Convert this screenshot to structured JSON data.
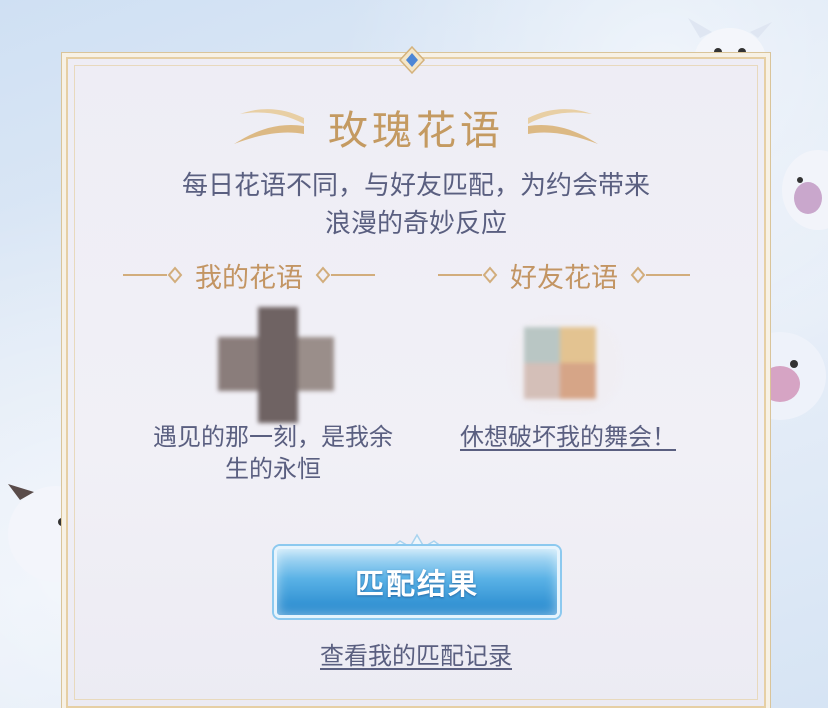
{
  "event": {
    "title": "玫瑰花语",
    "description_line1": "每日花语不同，与好友匹配，为约会带来",
    "description_line2": "浪漫的奇妙反应"
  },
  "mine": {
    "label": "我的花语",
    "caption_line1": "遇见的那一刻，是我余",
    "caption_line2": "生的永恒"
  },
  "friend": {
    "label": "好友花语",
    "caption": "休想破坏我的舞会！"
  },
  "actions": {
    "match_button": "匹配结果",
    "history_link": "查看我的匹配记录"
  },
  "colors": {
    "title_gold": "#c49a61",
    "body_text": "#5a5f80",
    "button_blue": "#2386cc"
  },
  "icons": [
    "gem-icon",
    "wing-ornament-icon",
    "divider-ornament-icon",
    "poro-mascot",
    "blue-rose-icon"
  ]
}
